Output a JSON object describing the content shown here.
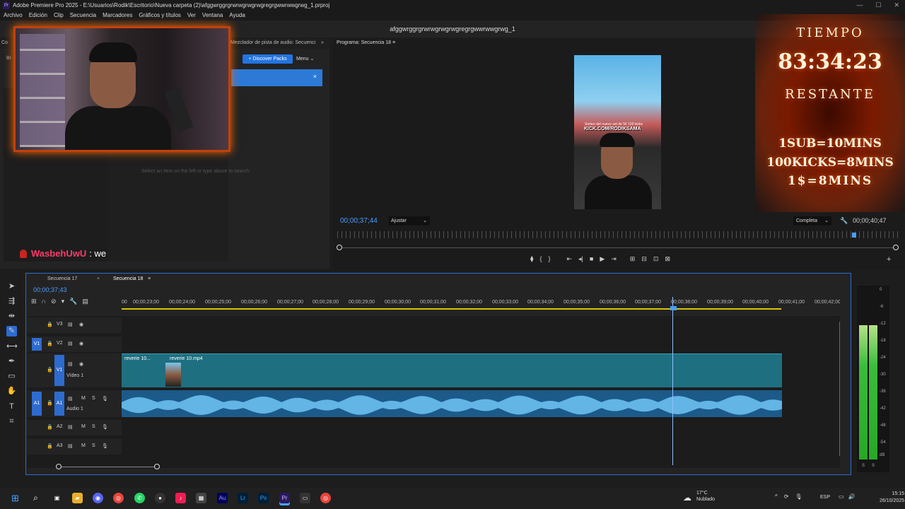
{
  "window": {
    "app_icon": "Pr",
    "title": "Adobe Premiere Pro 2025 - E:\\Usuarios\\Rodik\\Escritorio\\Nueva carpeta (2)\\afggwrggrgrwrwgrwgrwgregrgwwrwwgrwg_1.prproj"
  },
  "menu": [
    "Archivo",
    "Edición",
    "Clip",
    "Secuencia",
    "Marcadores",
    "Gráficos y títulos",
    "Ver",
    "Ventana",
    "Ayuda"
  ],
  "project_name": "afggwrggrgrwrwgrwgrwgregrgwwrwwgrwg_1",
  "source_panel": {
    "tab_left": "Co",
    "tab_left2": "Br",
    "mixer_tab": "Mezclador de pista de audio: Secuenci",
    "discover_label": "+ Discover Packs",
    "menu_label": "Menu",
    "close": "×",
    "hint": "Select an item on the left or type above to search."
  },
  "chat": {
    "user": "WasbehUwU",
    "message": ": we"
  },
  "program": {
    "title": "Programa: Secuencia 18",
    "timecode_left": "00;00;37;44",
    "fit_label": "Ajustar",
    "quality_label": "Completa",
    "timecode_right": "00;00;40;47",
    "video_caption": "Sorteo del nuevo set de 5€ 100 kicks",
    "video_overlay": "KICK.COM/RODIKSAMA",
    "transport": [
      "⧫",
      "{",
      "}",
      "⇤",
      "◂|",
      "■",
      "▶",
      "⇥",
      "⊞",
      "⊟",
      "⊡",
      "⊠",
      "⊕"
    ]
  },
  "stream_overlay": {
    "tiempo": "TIEMPO",
    "time": "83:34:23",
    "restante": "RESTANTE",
    "rule1": "1SUB=10MINS",
    "rule2": "100KICKS=8MINS",
    "rule3": "1$=8MINS"
  },
  "timeline": {
    "tabs": [
      "Secuencia 17",
      "Secuencia 18"
    ],
    "timecode": "00;00;37;43",
    "ruler_ticks": [
      "00",
      "00;00;23;00",
      "00;00;24;00",
      "00;00;25;00",
      "00;00;26;00",
      "00;00;27;00",
      "00;00;28;00",
      "00;00;29;00",
      "00;00;30;00",
      "00;00;31;00",
      "00;00;32;00",
      "00;00;33;00",
      "00;00;34;00",
      "00;00;35;00",
      "00;00;36;00",
      "00;00;37;00",
      "00;00;38;00",
      "00;00;39;00",
      "00;00;40;00",
      "00;00;41;00",
      "00;00;42;0C"
    ],
    "tracks": {
      "v3": "V3",
      "v2": "V2",
      "v1": "V1",
      "v1_name": "Vídeo 1",
      "a1": "A1",
      "a1_name": "Audio 1",
      "a2": "A2",
      "a3": "A3",
      "mute": "M",
      "solo": "S"
    },
    "clip_video_1": "reverie 10...",
    "clip_video_2": "reverie 10.mp4",
    "playhead_fraction": 0.767
  },
  "audio_meter": {
    "scale": [
      "0",
      "-6",
      "-12",
      "-18",
      "-24",
      "-30",
      "-36",
      "-42",
      "-48",
      "-54",
      "dB"
    ],
    "bottom": [
      "S",
      "S"
    ]
  },
  "taskbar": {
    "weather_temp": "17°C",
    "weather_desc": "Nublado",
    "lang": "ESP",
    "time": "15:15",
    "date": "26/10/2025"
  }
}
